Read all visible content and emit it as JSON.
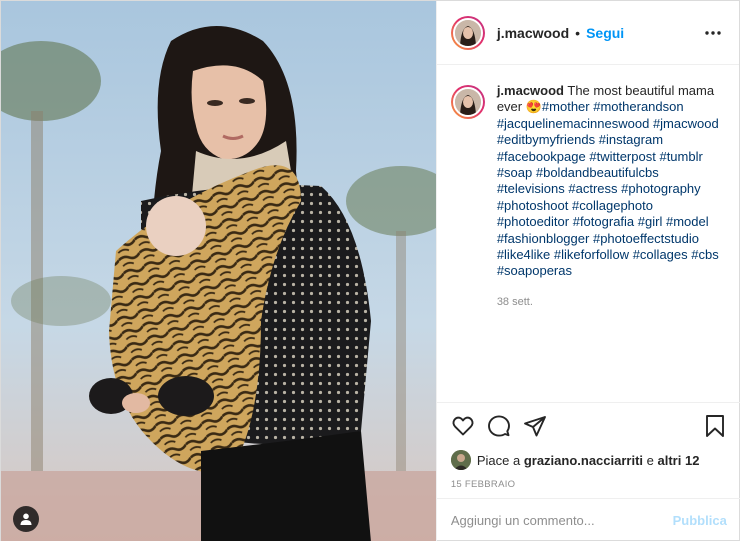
{
  "post": {
    "username": "j.macwood",
    "follow_label": "Segui",
    "dot": "•",
    "more_icon": "more-horizontal-icon",
    "caption": {
      "username": "j.macwood",
      "text": "The most beautiful mama ever",
      "emoji": "😍",
      "hashtags": [
        "#mother",
        "#motherandson",
        "#jacquelinemacinneswood",
        "#jmacwood",
        "#editbymyfriends",
        "#instagram",
        "#facebookpage",
        "#twitterpost",
        "#tumblr",
        "#soap",
        "#boldandbeautifulcbs",
        "#televisions",
        "#actress",
        "#photography",
        "#photoshoot",
        "#collagephoto",
        "#photoeditor",
        "#fotografia",
        "#girl",
        "#model",
        "#fashionblogger",
        "#photoeffectstudio",
        "#like4like",
        "#likeforfollow",
        "#collages",
        "#cbs",
        "#soapoperas"
      ],
      "time_ago": "38 sett."
    },
    "actions": {
      "like_icon": "heart-icon",
      "comment_icon": "comment-icon",
      "share_icon": "share-icon",
      "save_icon": "bookmark-icon"
    },
    "likes": {
      "prefix": "Piace a",
      "user": "graziano.nacciarriti",
      "middle": "e",
      "others": "altri 12"
    },
    "date": "15 FEBBRAIO",
    "comment": {
      "placeholder": "Aggiungi un commento...",
      "publish_label": "Pubblica"
    }
  },
  "colors": {
    "accent": "#0095f6",
    "hashtag": "#00376b",
    "muted": "#8e8e8e",
    "publish_disabled": "#b2dffc"
  }
}
